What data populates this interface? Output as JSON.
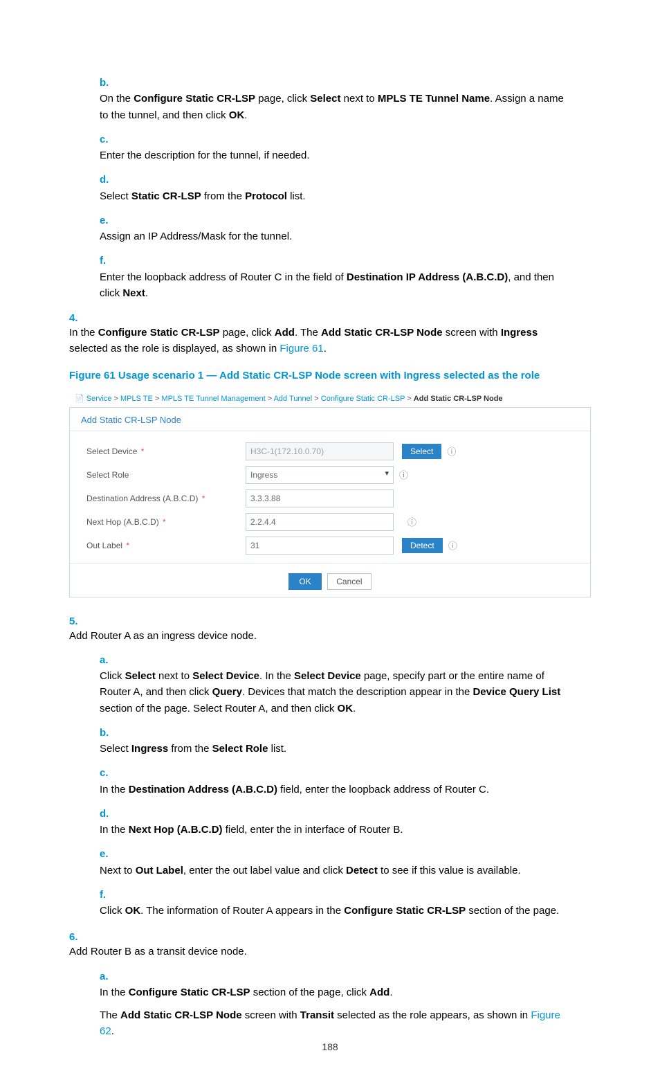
{
  "steps_top": {
    "b": {
      "m": "b.",
      "t1": "On the ",
      "t2": "Configure Static CR-LSP",
      "t3": " page, click ",
      "t4": "Select",
      "t5": " next to ",
      "t6": "MPLS TE Tunnel Name",
      "t7": ". Assign a name to the tunnel, and then click ",
      "t8": "OK",
      "t9": "."
    },
    "c": {
      "m": "c.",
      "t": "Enter the description for the tunnel, if needed."
    },
    "d": {
      "m": "d.",
      "t1": "Select ",
      "t2": "Static CR-LSP",
      "t3": " from the ",
      "t4": "Protocol",
      "t5": " list."
    },
    "e": {
      "m": "e.",
      "t": "Assign an IP Address/Mask for the tunnel."
    },
    "f": {
      "m": "f.",
      "t1": "Enter the loopback address of Router C in the field of ",
      "t2": "Destination IP Address (A.B.C.D)",
      "t3": ", and then click ",
      "t4": "Next",
      "t5": "."
    }
  },
  "step4": {
    "m": "4.",
    "t1": "In the ",
    "t2": "Configure Static CR-LSP",
    "t3": " page, click ",
    "t4": "Add",
    "t5": ". The ",
    "t6": "Add Static CR-LSP Node",
    "t7": " screen with ",
    "t8": "Ingress",
    "t9": " selected as the role is displayed, as shown in ",
    "link": "Figure 61",
    "t10": "."
  },
  "figure_caption": "Figure 61 Usage scenario 1 — Add Static CR-LSP Node screen with Ingress selected as the role",
  "screenshot": {
    "breadcrumb": {
      "service": "Service",
      "sep": " > ",
      "mplste": "MPLS TE",
      "mpltm": "MPLS TE Tunnel Management",
      "addt": "Add Tunnel",
      "cfg": "Configure Static CR-LSP",
      "last": "Add Static CR-LSP Node"
    },
    "panel_title": "Add Static CR-LSP Node",
    "rows": {
      "device": {
        "label": "Select Device",
        "req": "*",
        "value": "H3C-1(172.10.0.70)",
        "btn": "Select"
      },
      "role": {
        "label": "Select Role",
        "value": "Ingress"
      },
      "dest": {
        "label": "Destination Address (A.B.C.D)",
        "req": "*",
        "value": "3.3.3.88"
      },
      "nexthop": {
        "label": "Next Hop (A.B.C.D)",
        "req": "*",
        "value": "2.2.4.4"
      },
      "outlabel": {
        "label": "Out Label",
        "req": "*",
        "value": "31",
        "btn": "Detect"
      }
    },
    "footer": {
      "ok": "OK",
      "cancel": "Cancel"
    }
  },
  "step5": {
    "m": "5.",
    "t": "Add Router A as an ingress device node.",
    "a": {
      "m": "a.",
      "t1": "Click ",
      "t2": "Select",
      "t3": " next to ",
      "t4": "Select Device",
      "t5": ". In the ",
      "t6": "Select Device",
      "t7": " page, specify part or the entire name of Router A, and then click ",
      "t8": "Query",
      "t9": ". Devices that match the description appear in the ",
      "t10": "Device Query List",
      "t11": " section of the page. Select Router A, and then click ",
      "t12": "OK",
      "t13": "."
    },
    "b": {
      "m": "b.",
      "t1": "Select ",
      "t2": "Ingress",
      "t3": " from the ",
      "t4": "Select Role",
      "t5": " list."
    },
    "c": {
      "m": "c.",
      "t1": "In the ",
      "t2": "Destination Address (A.B.C.D)",
      "t3": " field, enter the loopback address of Router C."
    },
    "d": {
      "m": "d.",
      "t1": "In the ",
      "t2": "Next Hop (A.B.C.D)",
      "t3": " field, enter the in interface of Router B."
    },
    "e": {
      "m": "e.",
      "t1": "Next to ",
      "t2": "Out Label",
      "t3": ", enter the out label value and click ",
      "t4": "Detect",
      "t5": " to see if this value is available."
    },
    "f": {
      "m": "f.",
      "t1": "Click ",
      "t2": "OK",
      "t3": ". The information of Router A appears in the ",
      "t4": "Configure Static CR-LSP",
      "t5": " section of the page."
    }
  },
  "step6": {
    "m": "6.",
    "t": "Add Router B as a transit device node.",
    "a": {
      "m": "a.",
      "t1": "In the ",
      "t2": "Configure Static CR-LSP",
      "t3": " section of the page, click ",
      "t4": "Add",
      "t5": ".",
      "p2a": "The ",
      "p2b": "Add Static CR-LSP Node",
      "p2c": " screen with ",
      "p2d": "Transit",
      "p2e": " selected as the role appears, as shown in ",
      "link": "Figure 62",
      "p2f": "."
    }
  },
  "page_number": "188"
}
